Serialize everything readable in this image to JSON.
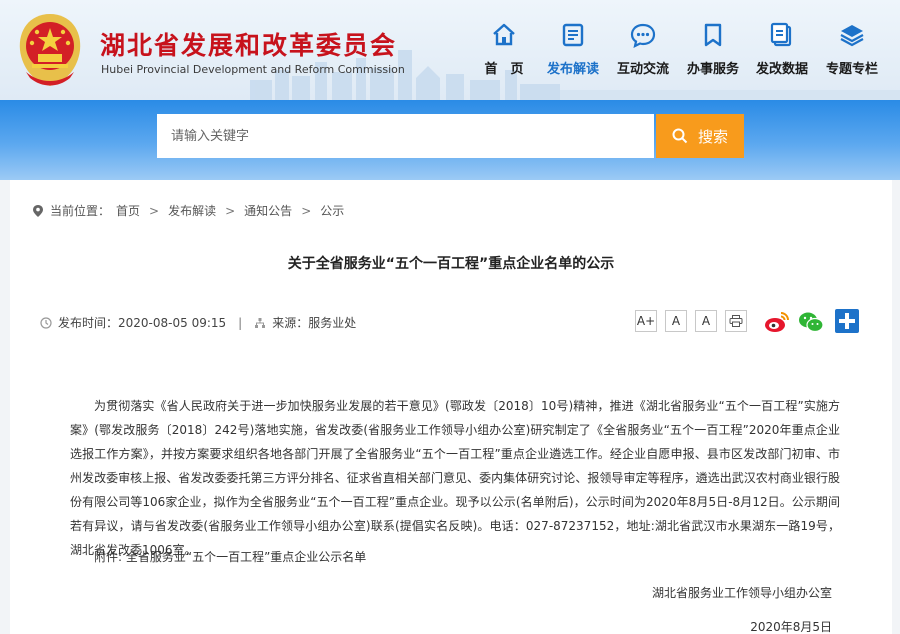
{
  "site": {
    "title": "湖北省发展和改革委员会",
    "subtitle": "Hubei Provincial Development and Reform Commission"
  },
  "nav": [
    {
      "label": "首　页",
      "icon": "home-icon"
    },
    {
      "label": "发布解读",
      "icon": "document-icon"
    },
    {
      "label": "互动交流",
      "icon": "chat-icon"
    },
    {
      "label": "办事服务",
      "icon": "bookmark-icon"
    },
    {
      "label": "发改数据",
      "icon": "data-icon"
    },
    {
      "label": "专题专栏",
      "icon": "layers-icon"
    }
  ],
  "search": {
    "placeholder": "请输入关键字",
    "button_label": "搜索"
  },
  "breadcrumb": {
    "prefix": "当前位置：",
    "items": [
      "首页",
      "发布解读",
      "通知公告",
      "公示"
    ]
  },
  "article": {
    "title": "关于全省服务业“五个一百工程”重点企业名单的公示",
    "publish_label": "发布时间：",
    "publish_time": "2020-08-05 09:15",
    "source_label": "来源：",
    "source": "服务业处",
    "font_buttons": [
      "A+",
      "A",
      "A"
    ],
    "body": "为贯彻落实《省人民政府关于进一步加快服务业发展的若干意见》(鄂政发〔2018〕10号)精神，推进《湖北省服务业“五个一百工程”实施方案》(鄂发改服务〔2018〕242号)落地实施，省发改委(省服务业工作领导小组办公室)研究制定了《全省服务业“五个一百工程”2020年重点企业选报工作方案》，并按方案要求组织各地各部门开展了全省服务业“五个一百工程”重点企业遴选工作。经企业自愿申报、县市区发改部门初审、市州发改委审核上报、省发改委委托第三方评分排名、征求省直相关部门意见、委内集体研究讨论、报领导审定等程序，遴选出武汉农村商业银行股份有限公司等106家企业，拟作为全省服务业“五个一百工程”重点企业。现予以公示(名单附后)，公示时间为2020年8月5日-8月12日。公示期间若有异议，请与省发改委(省服务业工作领导小组办公室)联系(提倡实名反映)。电话：027-87237152，地址:湖北省武汉市水果湖东一路19号，湖北省发改委1006室。",
    "attachment": "附件: 全省服务业“五个一百工程”重点企业公示名单",
    "signature_org": "湖北省服务业工作领导小组办公室",
    "signature_date": "2020年8月5日"
  },
  "colors": {
    "brand_red": "#c7121c",
    "accent_blue": "#1d72c9",
    "search_orange": "#f89b1c"
  }
}
